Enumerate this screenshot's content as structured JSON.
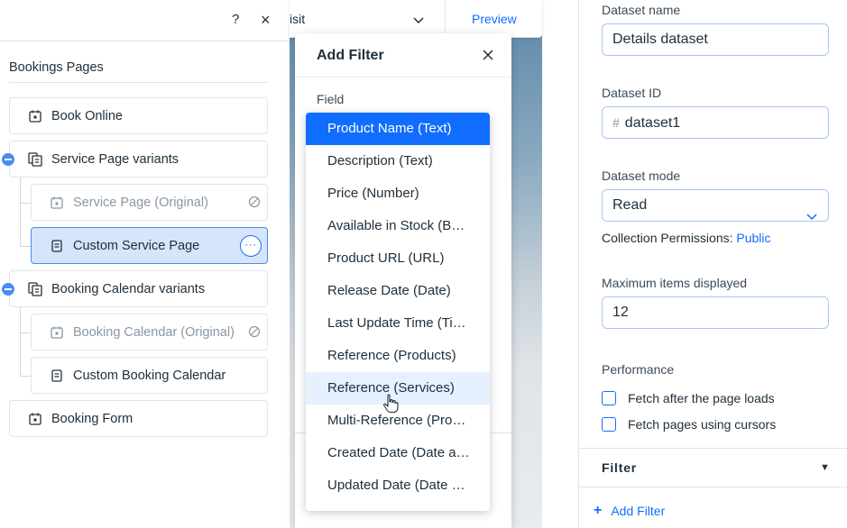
{
  "left_panel": {
    "title": "Bookings Pages",
    "items": [
      {
        "label": "Book Online"
      },
      {
        "label": "Service Page variants"
      },
      {
        "label": "Service Page (Original)"
      },
      {
        "label": "Custom Service Page"
      },
      {
        "label": "Booking Calendar variants"
      },
      {
        "label": "Booking Calendar (Original)"
      },
      {
        "label": "Custom Booking Calendar"
      },
      {
        "label": "Booking Form"
      }
    ],
    "help_icon": "?",
    "close_icon": "×",
    "more_label": "···"
  },
  "canvas_bar": {
    "page_select": "isit",
    "preview": "Preview"
  },
  "add_filter": {
    "title": "Add Filter",
    "field_label": "Field",
    "options": [
      "Product Name (Text)",
      "Description (Text)",
      "Price (Number)",
      "Available in Stock (Boolean)",
      "Product URL (URL)",
      "Release Date (Date)",
      "Last Update Time (Time)",
      "Reference (Products)",
      "Reference (Services)",
      "Multi-Reference (Products)",
      "Created Date (Date and Time)",
      "Updated Date (Date and Time)"
    ],
    "selected_index": 0,
    "hover_index": 8
  },
  "right_panel": {
    "dataset_name_label": "Dataset name",
    "dataset_name_value": "Details dataset",
    "dataset_id_label": "Dataset ID",
    "dataset_id_hash": "#",
    "dataset_id_value": "dataset1",
    "dataset_mode_label": "Dataset mode",
    "dataset_mode_value": "Read",
    "permissions_text": "Collection Permissions:",
    "permissions_link": "Public",
    "max_items_label": "Maximum items displayed",
    "max_items_value": "12",
    "performance_label": "Performance",
    "fetch_after_label": "Fetch after the page loads",
    "fetch_cursors_label": "Fetch pages using cursors",
    "filter_section": "Filter",
    "filter_arrow": "▼",
    "add_filter_plus": "+",
    "add_filter_link": "Add Filter"
  },
  "colors": {
    "accent": "#116dff",
    "selected_bg": "#d6e5fb",
    "hover_bg": "#e7f0ff",
    "text": "#20303c",
    "muted": "#8a97a3"
  }
}
